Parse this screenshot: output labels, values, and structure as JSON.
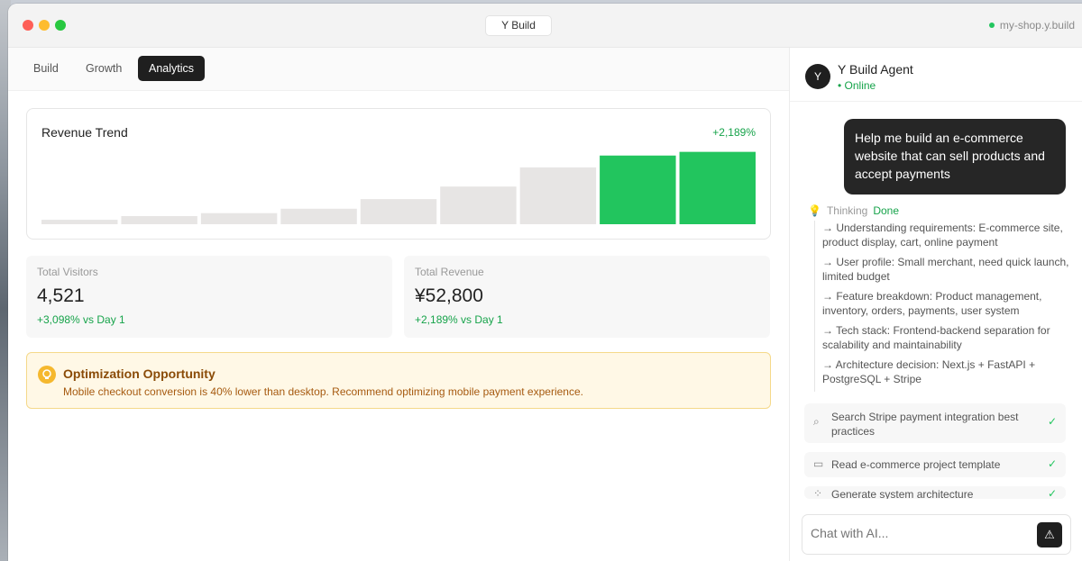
{
  "window": {
    "title": "Y Build",
    "domain": "my-shop.y.build"
  },
  "tabs": [
    "Build",
    "Growth",
    "Analytics"
  ],
  "active_tab": "Analytics",
  "revenue_card": {
    "title": "Revenue Trend",
    "change": "+2,189%"
  },
  "chart_data": {
    "type": "bar",
    "title": "Revenue Trend",
    "categories": [
      "",
      "",
      "",
      "",
      "",
      "",
      "",
      "",
      ""
    ],
    "values": [
      6,
      11,
      15,
      21,
      34,
      51,
      77,
      93,
      98
    ],
    "ylim": [
      0,
      100
    ],
    "highlight_indices": [
      7,
      8
    ],
    "colors": {
      "base": "#e7e5e4",
      "highlight": "#22c55e"
    }
  },
  "stats": {
    "visitors": {
      "label": "Total Visitors",
      "value": "4,521",
      "change": "+3,098% vs Day 1"
    },
    "revenue": {
      "label": "Total Revenue",
      "value": "¥52,800",
      "change": "+2,189% vs Day 1"
    }
  },
  "opportunity": {
    "title": "Optimization Opportunity",
    "description": "Mobile checkout conversion is 40% lower than desktop. Recommend optimizing mobile payment experience."
  },
  "agent": {
    "avatar_letter": "Y",
    "name": "Y Build Agent",
    "status": "• Online"
  },
  "chat": {
    "user_message": "Help me build an e-commerce website that can sell products and accept payments",
    "thinking_label": "Thinking",
    "thinking_status": "Done",
    "steps": [
      "→ Understanding requirements: E-commerce site, product display, cart, online payment",
      "→ User profile: Small merchant, need quick launch, limited budget",
      "→ Feature breakdown: Product management, inventory, orders, payments, user system",
      "→ Tech stack: Frontend-backend separation for scalability and maintainability",
      "→ Architecture decision: Next.js + FastAPI + PostgreSQL + Stripe"
    ],
    "tools": [
      {
        "icon": "search-icon",
        "label": "Search Stripe payment integration best practices",
        "status": "✓"
      },
      {
        "icon": "folder-icon",
        "label": "Read e-commerce project template",
        "status": "✓"
      },
      {
        "icon": "grid-icon",
        "label": "Generate system architecture",
        "status": "✓"
      }
    ],
    "input_placeholder": "Chat with AI..."
  },
  "colors": {
    "accent_green": "#22c55e",
    "dark": "#1f1f1f",
    "warning_bg": "#fff8e6"
  }
}
